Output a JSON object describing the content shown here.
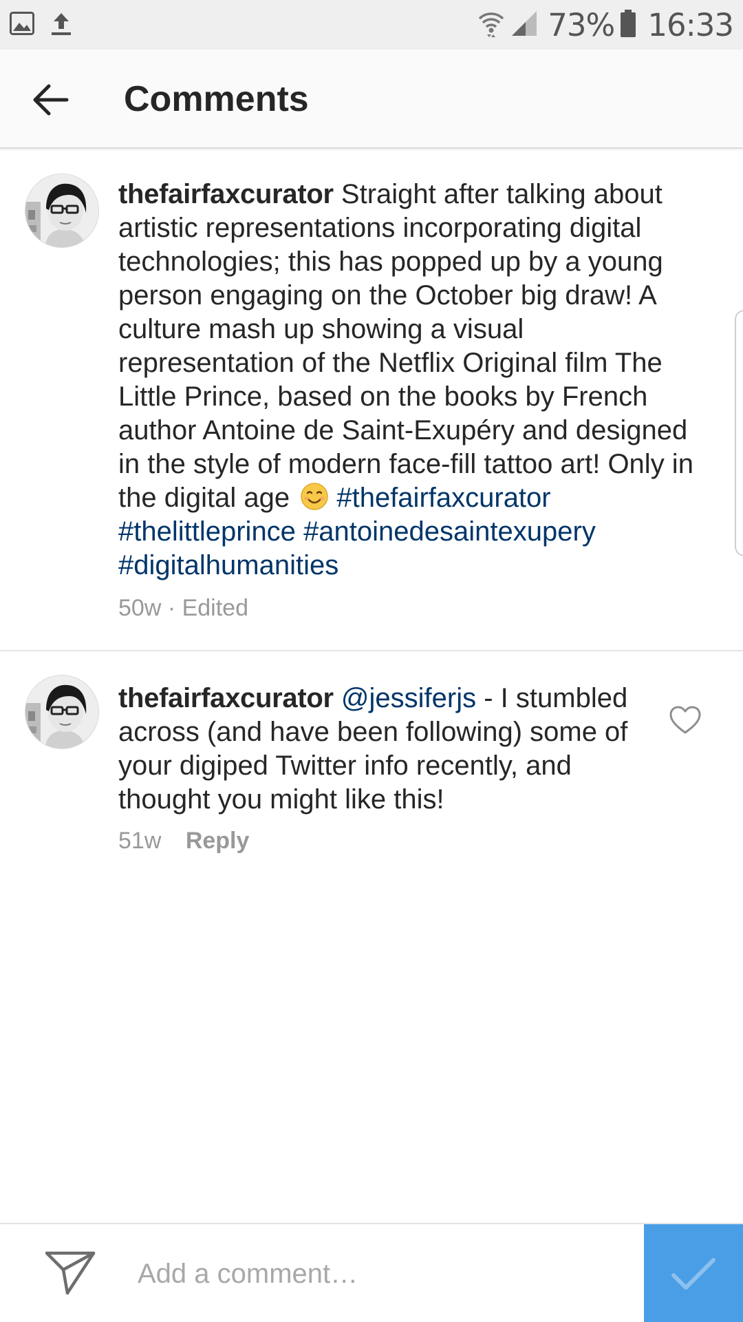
{
  "status_bar": {
    "battery_percent": "73%",
    "time": "16:33",
    "icons": [
      "image-icon",
      "upload-icon",
      "wifi-icon",
      "signal-icon",
      "battery-icon"
    ]
  },
  "header": {
    "title": "Comments",
    "back_icon": "back-arrow-icon"
  },
  "comments": [
    {
      "username": "thefairfaxcurator",
      "text": "Straight after talking about artistic representations incorporating digital technologies; this has popped up by a young person engaging on the October big draw! A culture mash up showing a visual representation of the Netflix Original film The Little Prince, based on the books by French author Antoine de Saint-Exupéry and designed in the style of modern face-fill tattoo art! Only in the digital age",
      "emoji": "smiling-face-emoji",
      "hashtags": [
        "#thefairfaxcurator",
        "#thelittleprince",
        "#antoinedesaintexupery",
        "#digitalhumanities"
      ],
      "meta": "50w · Edited"
    },
    {
      "username": "thefairfaxcurator",
      "mention": "@jessiferjs",
      "text": "- I stumbled across (and have been following) some of your digiped Twitter info recently, and thought you might like this!",
      "age": "51w",
      "reply_label": "Reply",
      "like_icon": "heart-outline-icon"
    }
  ],
  "composer": {
    "placeholder": "Add a comment…",
    "direct_icon": "paper-plane-icon",
    "post_icon": "checkmark-icon"
  },
  "colors": {
    "link": "#003569",
    "meta": "#999999",
    "post_button": "#4a9ee6",
    "header_bg": "#fafafa",
    "status_bar_bg": "#efefef"
  }
}
